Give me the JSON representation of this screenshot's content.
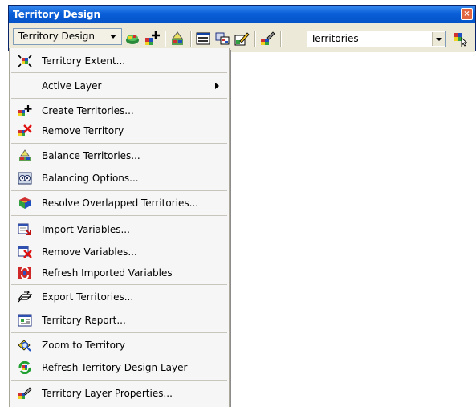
{
  "toolbar": {
    "title": "Territory Design",
    "menu_button_label": "Territory Design",
    "layer_combo_value": "Territories",
    "icons": [
      "balance-tool-icon",
      "create-territories-icon",
      "balance-territories-icon",
      "territory-report-icon",
      "import-variables-icon",
      "edit-territory-icon",
      "layer-properties-icon",
      "select-tool-icon"
    ]
  },
  "menu": {
    "items": [
      {
        "label": "Territory Extent...",
        "icon": "territory-extent-icon"
      },
      {
        "label": "Active Layer",
        "icon": "",
        "submenu": true
      },
      {
        "label": "Create Territories...",
        "icon": "create-territories-icon"
      },
      {
        "label": "Remove Territory",
        "icon": "remove-territory-icon"
      },
      {
        "label": "Balance Territories...",
        "icon": "balance-territories-icon"
      },
      {
        "label": "Balancing Options...",
        "icon": "balancing-options-icon"
      },
      {
        "label": "Resolve Overlapped Territories...",
        "icon": "resolve-overlap-icon"
      },
      {
        "label": "Import Variables...",
        "icon": "import-variables-icon"
      },
      {
        "label": "Remove Variables...",
        "icon": "remove-variables-icon"
      },
      {
        "label": "Refresh Imported Variables",
        "icon": "refresh-variables-icon"
      },
      {
        "label": "Export Territories...",
        "icon": "export-territories-icon"
      },
      {
        "label": "Territory Report...",
        "icon": "territory-report-icon"
      },
      {
        "label": "Zoom to Territory",
        "icon": "zoom-territory-icon"
      },
      {
        "label": "Refresh Territory Design Layer",
        "icon": "refresh-layer-icon"
      },
      {
        "label": "Territory Layer Properties...",
        "icon": "layer-properties-icon"
      }
    ]
  }
}
